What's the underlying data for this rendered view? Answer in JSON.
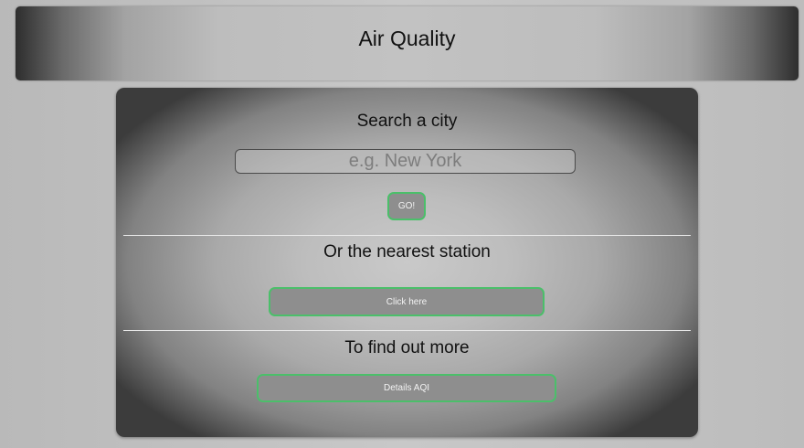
{
  "header": {
    "title": "Air Quality"
  },
  "search": {
    "heading": "Search a city",
    "placeholder": "e.g. New York",
    "value": "",
    "go_label": "GO!"
  },
  "nearest": {
    "heading": "Or the nearest station",
    "button_label": "Click here"
  },
  "more": {
    "heading": "To find out more",
    "button_label": "Details AQI"
  },
  "colors": {
    "button_border": "#4bbf6a",
    "button_fill": "#8e8e8e",
    "divider": "#e9e9e9"
  }
}
